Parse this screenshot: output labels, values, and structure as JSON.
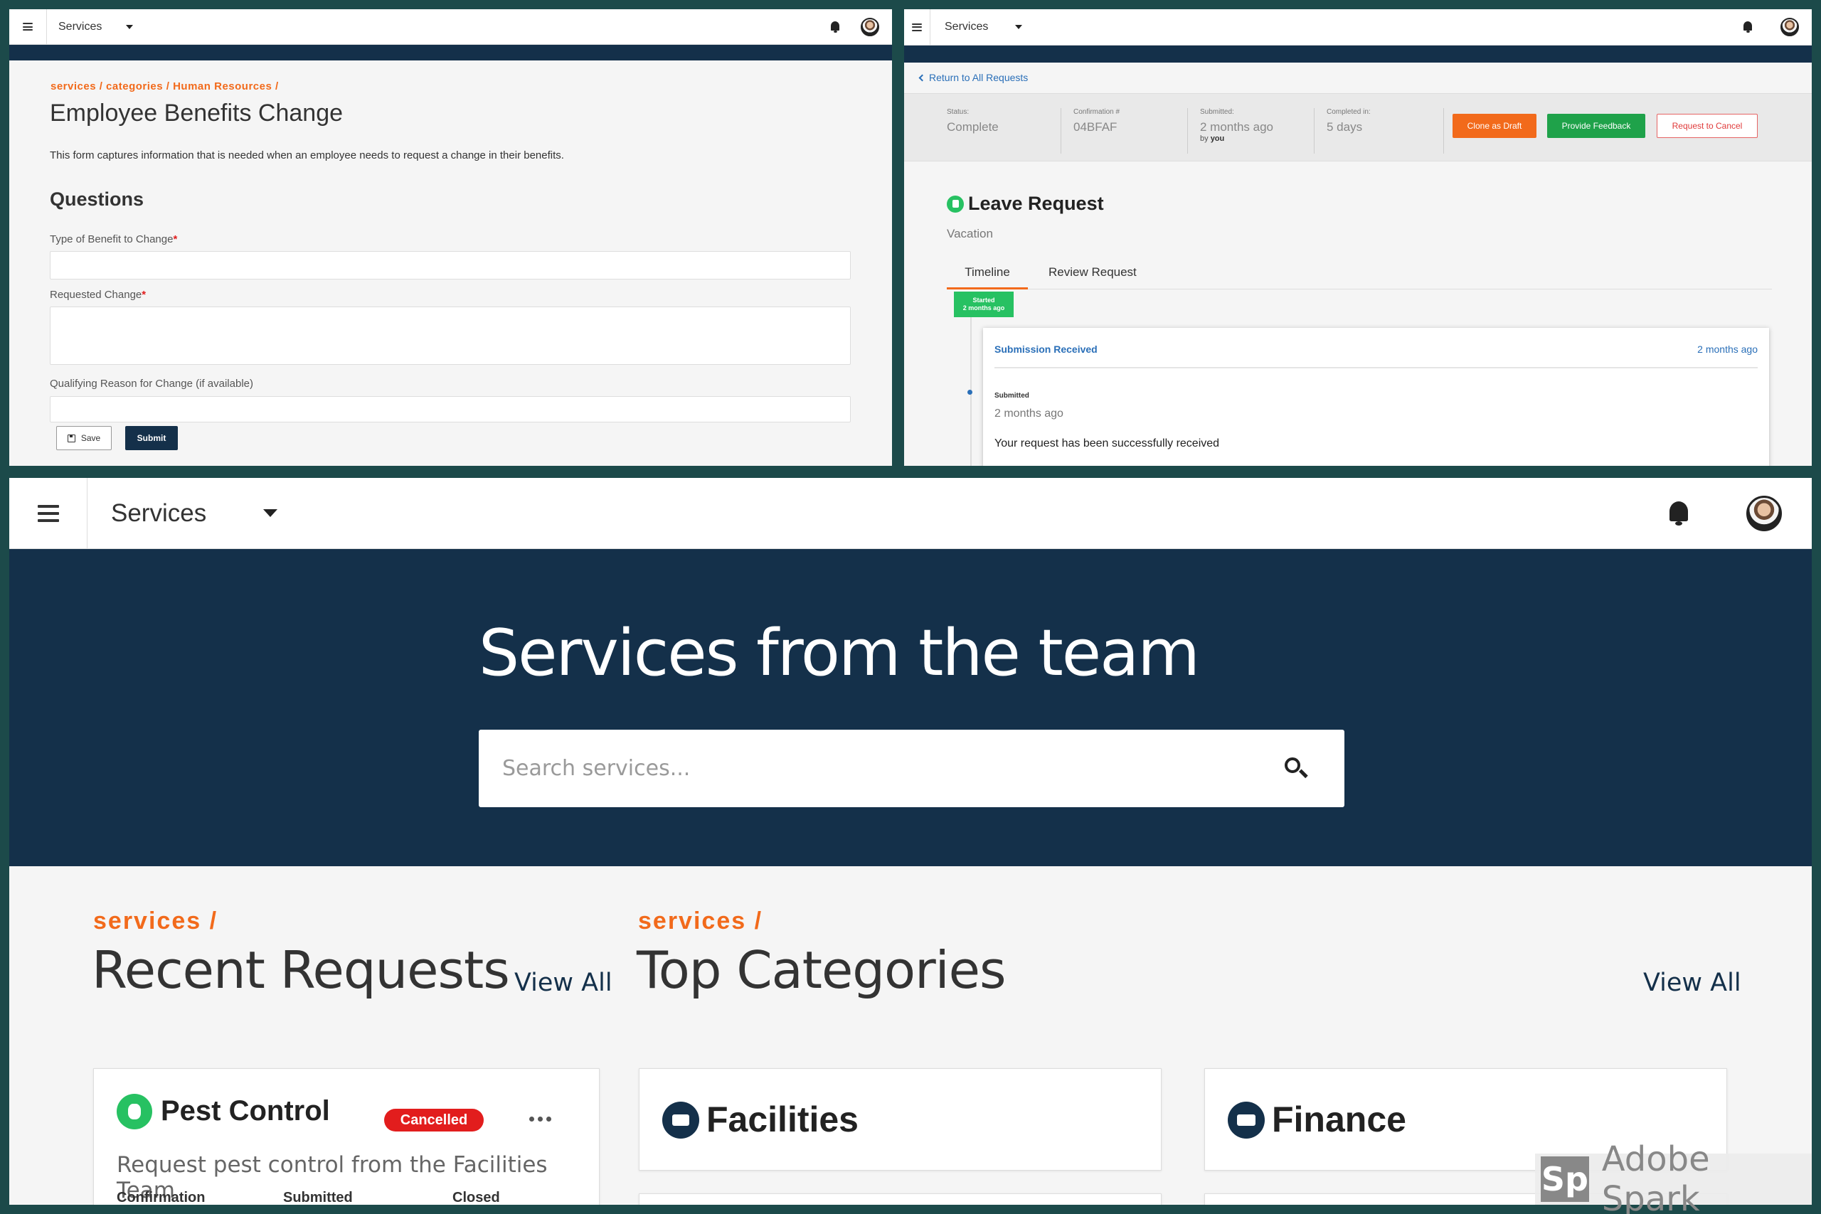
{
  "panel1": {
    "app_title": "Services",
    "breadcrumb": "services / categories / Human Resources /",
    "page_title": "Employee Benefits Change",
    "description": "This form captures information that is needed when an employee needs to request a change in their benefits.",
    "section_heading": "Questions",
    "fields": [
      {
        "label": "Type of Benefit to Change",
        "required_mark": "*"
      },
      {
        "label": "Requested Change",
        "required_mark": "*"
      },
      {
        "label": "Qualifying Reason for Change (if available)"
      }
    ],
    "save_label": "Save",
    "submit_label": "Submit"
  },
  "panel2": {
    "app_title": "Services",
    "back_link": "Return to All Requests",
    "status": {
      "label": "Status:",
      "value": "Complete"
    },
    "confirmation": {
      "label": "Confirmation #",
      "value": "04BFAF"
    },
    "submitted": {
      "label": "Submitted:",
      "value": "2 months ago",
      "by_prefix": "by",
      "by_user": "you"
    },
    "completed": {
      "label": "Completed in:",
      "value": "5 days"
    },
    "buttons": {
      "clone": "Clone as Draft",
      "feedback": "Provide Feedback",
      "cancel": "Request to Cancel"
    },
    "request_title": "Leave Request",
    "request_subtitle": "Vacation",
    "tabs": [
      "Timeline",
      "Review Request"
    ],
    "started_badge": {
      "label": "Started",
      "time": "2 months ago"
    },
    "timeline_card": {
      "heading": "Submission Received",
      "time_ago": "2 months ago",
      "field_label": "Submitted",
      "field_value": "2 months ago",
      "message": "Your request has been successfully received"
    }
  },
  "panel3": {
    "app_title": "Services",
    "hero_title": "Services from the team",
    "search_placeholder": "Search services...",
    "recent": {
      "crumb": "services /",
      "title": "Recent Requests",
      "view_all": "View All"
    },
    "categories": {
      "crumb": "services /",
      "title": "Top Categories",
      "view_all": "View All"
    },
    "recent_card": {
      "title": "Pest Control",
      "badge": "Cancelled",
      "description": "Request pest control from the Facilities Team",
      "columns": [
        "Confirmation",
        "Submitted",
        "Closed"
      ]
    },
    "category_cards": [
      "Facilities",
      "Finance"
    ]
  },
  "watermark": {
    "logo": "Sp",
    "text": "Adobe Spark"
  },
  "colors": {
    "navy": "#14304a",
    "orange": "#f26a1b",
    "green": "#1fa24a",
    "red": "#e21d1d",
    "link_blue": "#2a6fb8",
    "frame": "#1c4a4a"
  },
  "icons": [
    "hamburger-menu-icon",
    "caret-down-icon",
    "bell-icon",
    "avatar",
    "save-icon",
    "chevron-left-icon",
    "search-icon",
    "bug-icon",
    "truck-icon",
    "money-icon",
    "more-dots-icon"
  ]
}
